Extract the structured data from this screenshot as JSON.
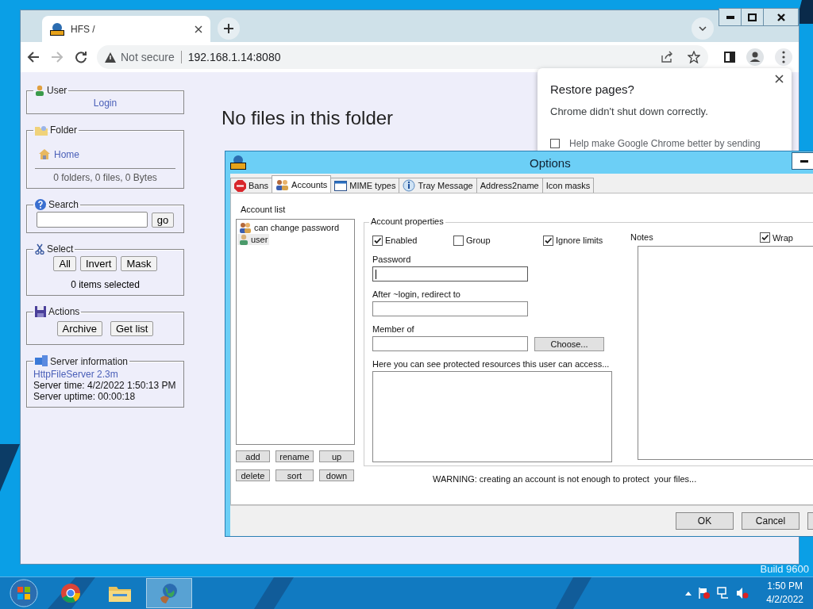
{
  "desktop": {
    "build_text": "Build 9600"
  },
  "browser": {
    "tab_title": "HFS /",
    "security_label": "Not secure",
    "url": "192.168.1.14:8080"
  },
  "restore_popup": {
    "title": "Restore pages?",
    "message": "Chrome didn't shut down correctly.",
    "consent": {
      "label": "Help make Google Chrome better by sending",
      "checked": false
    }
  },
  "hfs": {
    "user": {
      "title": "User",
      "link": "Login"
    },
    "folder": {
      "title": "Folder",
      "link": "Home",
      "summary": "0 folders, 0 files, 0 Bytes"
    },
    "search": {
      "title": "Search",
      "button": "go"
    },
    "select": {
      "title": "Select",
      "buttons": [
        "All",
        "Invert",
        "Mask"
      ],
      "status": "0 items selected"
    },
    "actions": {
      "title": "Actions",
      "buttons": [
        "Archive",
        "Get list"
      ]
    },
    "server": {
      "title": "Server information",
      "link": "HttpFileServer 2.3m",
      "lines": [
        "Server time: 4/2/2022 1:50:13 PM",
        "Server uptime: 00:00:18"
      ]
    },
    "message": "No files in this folder"
  },
  "options": {
    "title": "Options",
    "tabs": [
      {
        "label": "Bans",
        "kind": "stop",
        "selected": false
      },
      {
        "label": "Accounts",
        "kind": "users",
        "selected": true
      },
      {
        "label": "MIME types",
        "kind": "window",
        "selected": false
      },
      {
        "label": "Tray Message",
        "kind": "info",
        "selected": false
      },
      {
        "label": "Address2name",
        "kind": "plain",
        "selected": false
      },
      {
        "label": "Icon masks",
        "kind": "plain",
        "selected": false
      }
    ],
    "account_list_label": "Account list",
    "accounts": [
      {
        "name": "can change password",
        "kind": "group",
        "selected": false
      },
      {
        "name": "user",
        "kind": "user",
        "selected": true
      }
    ],
    "list_buttons": [
      "add",
      "rename",
      "up",
      "delete",
      "sort",
      "down"
    ],
    "properties_label": "Account properties",
    "flags": [
      {
        "label": "Enabled",
        "checked": true
      },
      {
        "label": "Group",
        "checked": false
      },
      {
        "label": "Ignore limits",
        "checked": true
      }
    ],
    "password": {
      "label": "Password",
      "focused": true
    },
    "redirect_label": "After ~login, redirect to",
    "member_label": "Member of",
    "choose_button": "Choose...",
    "resources_label": "Here you can see protected resources this user can access...",
    "notes_label": "Notes",
    "wrap": {
      "label": "Wrap",
      "checked": true
    },
    "warning": "WARNING: creating an account is not enough to protect  your files...",
    "buttons": [
      "OK",
      "Cancel"
    ]
  },
  "taskbar": {
    "apps": [
      {
        "kind": "chrome",
        "selected": false
      },
      {
        "kind": "explorer",
        "selected": false
      },
      {
        "kind": "hfs",
        "selected": true
      }
    ],
    "time": "1:50 PM",
    "date": "4/2/2022"
  }
}
